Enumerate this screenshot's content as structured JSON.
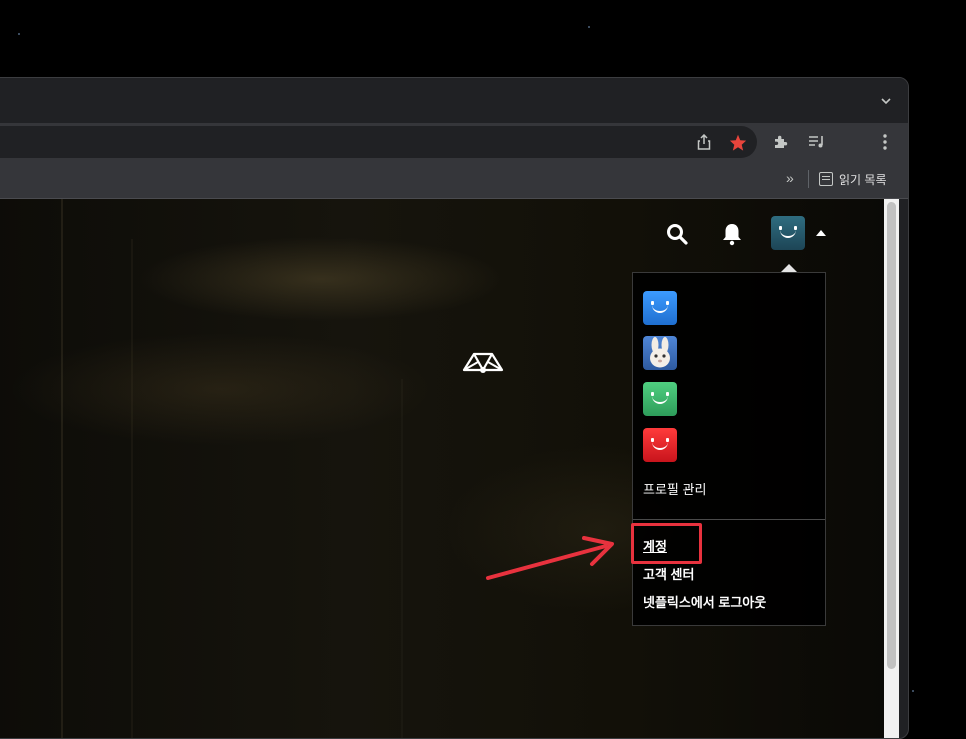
{
  "browser": {
    "tab_strip_chevron": "chevron-down-icon",
    "toolbar_icons": [
      "share-icon",
      "bookmark-star-icon",
      "extensions-puzzle-icon",
      "media-queue-icon",
      "kebab-menu-icon"
    ],
    "bookmark_overflow": "»",
    "reading_list_label": "읽기 목록",
    "accent_star_color": "#e8453c"
  },
  "site_nav": {
    "icons": [
      "search-icon",
      "bell-icon",
      "current-profile-avatar",
      "caret-up-icon"
    ],
    "current_avatar_color": "#2a5c6e"
  },
  "profile_menu": {
    "profiles": [
      {
        "icon": "smile-avatar-blue",
        "color": "#2f86e8"
      },
      {
        "icon": "rabbit-avatar",
        "color": "#6a8fc4"
      },
      {
        "icon": "smile-avatar-green",
        "color": "#3fb86e"
      },
      {
        "icon": "smile-avatar-red",
        "color": "#e8262b"
      }
    ],
    "manage_profiles_label": "프로필 관리",
    "account_label": "계정",
    "help_center_label": "고객 센터",
    "sign_out_label": "넷플릭스에서 로그아웃"
  },
  "annotation": {
    "highlight_color": "#e8323e"
  }
}
